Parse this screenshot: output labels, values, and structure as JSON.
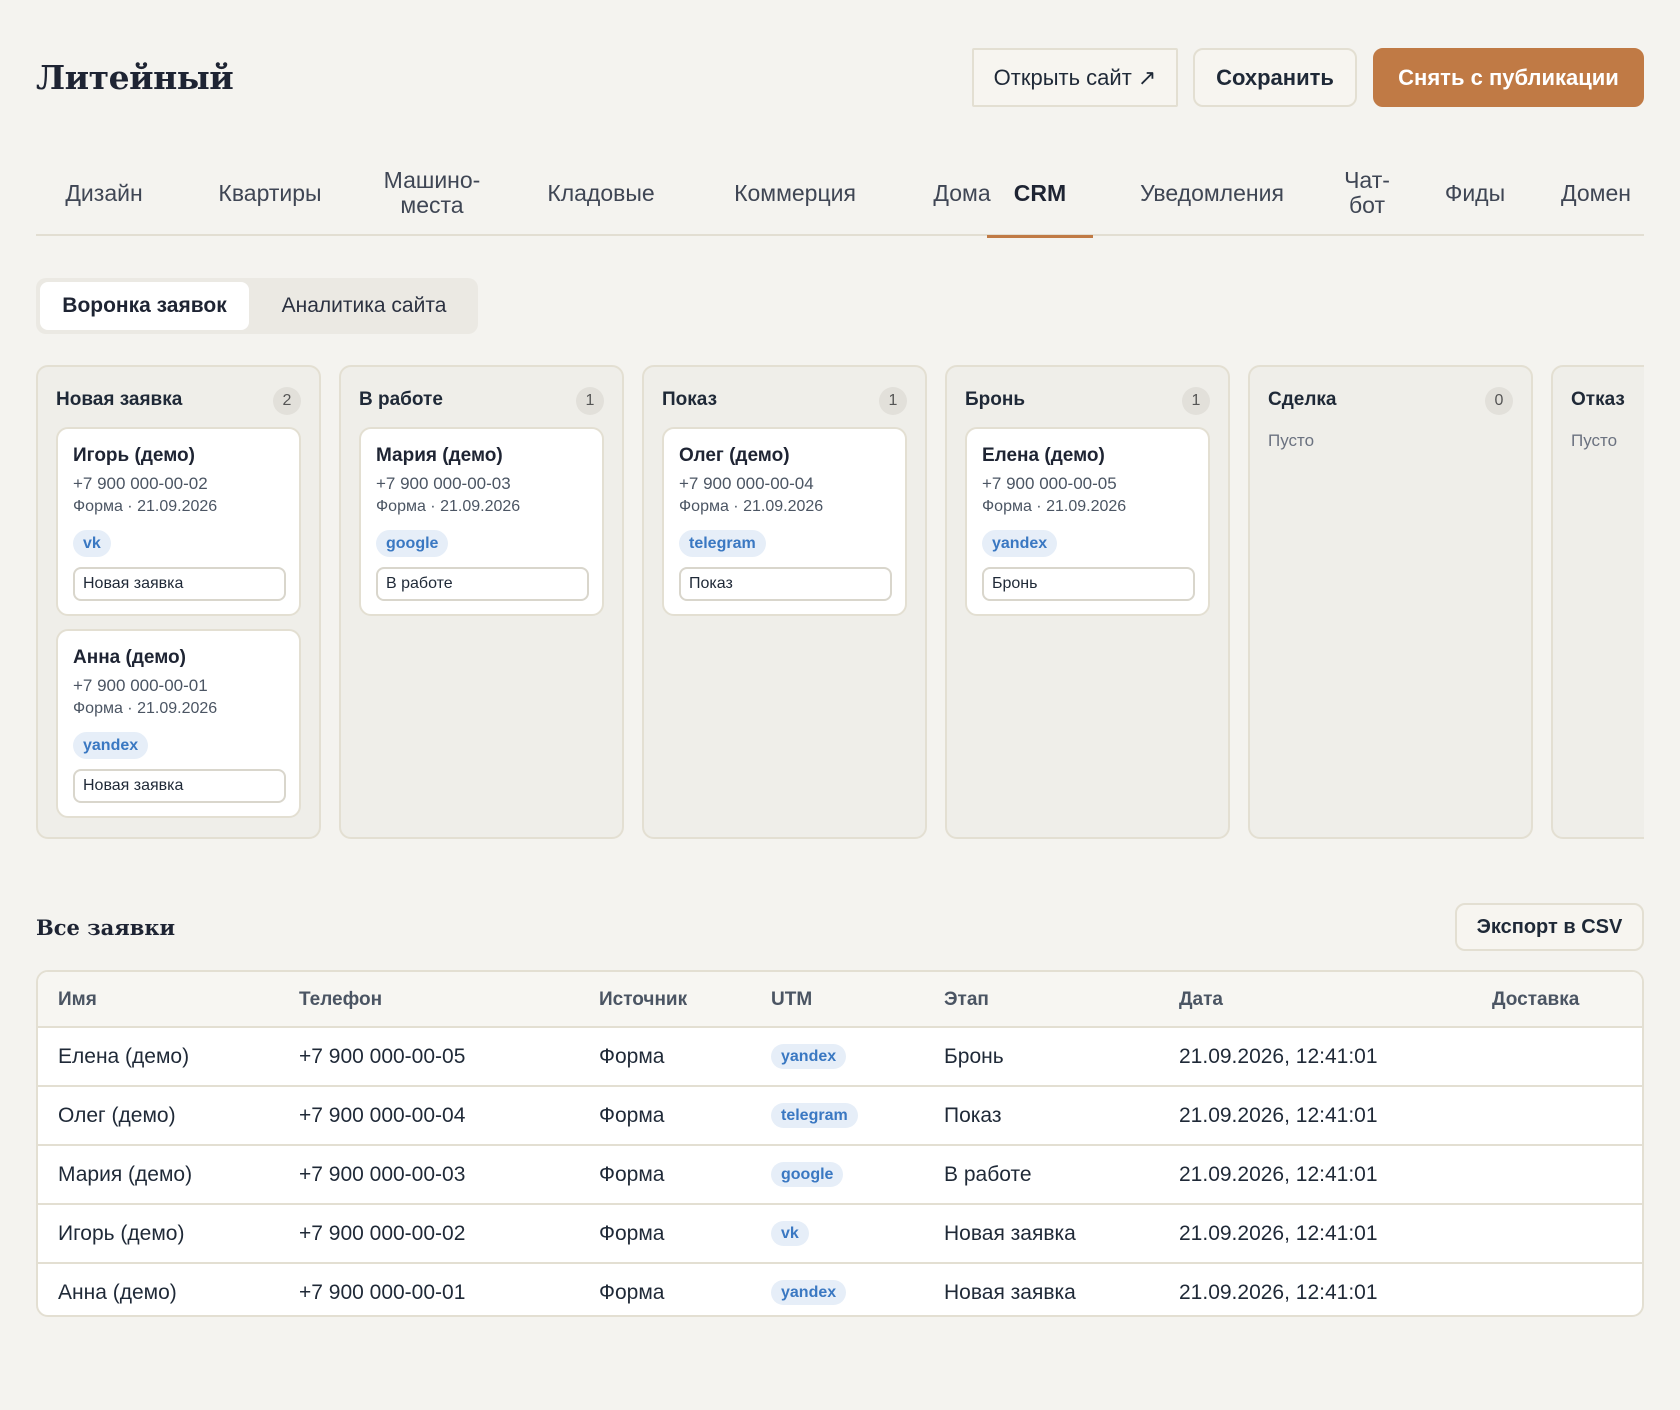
{
  "app": {
    "title": "Литейный"
  },
  "header": {
    "open_site_label": "Открыть сайт ↗",
    "save_label": "Сохранить",
    "unpublish_label": "Снять с публикации"
  },
  "tabs": [
    {
      "label": "Дизайн"
    },
    {
      "label": "Квартиры"
    },
    {
      "label": "Машино-места"
    },
    {
      "label": "Кладовые"
    },
    {
      "label": "Коммерция"
    },
    {
      "label": "Дома"
    },
    {
      "label": "CRM"
    },
    {
      "label": "Уведомления"
    },
    {
      "label": "Чат-бот"
    },
    {
      "label": "Фиды"
    },
    {
      "label": "Домен"
    }
  ],
  "subtabs": {
    "funnel": "Воронка заявок",
    "analytics": "Аналитика сайта"
  },
  "board": {
    "empty_label": "Пусто",
    "columns": [
      {
        "title": "Новая заявка",
        "count": "2"
      },
      {
        "title": "В работе",
        "count": "1"
      },
      {
        "title": "Показ",
        "count": "1"
      },
      {
        "title": "Бронь",
        "count": "1"
      },
      {
        "title": "Сделка",
        "count": "0"
      },
      {
        "title": "Отказ",
        "count": ""
      }
    ],
    "cards": [
      {
        "name": "Игорь (демо)",
        "phone": "+7 900 000-00-02",
        "meta": "Форма · 21.09.2026",
        "tag": "vk",
        "stage": "Новая заявка"
      },
      {
        "name": "Анна (демо)",
        "phone": "+7 900 000-00-01",
        "meta": "Форма · 21.09.2026",
        "tag": "yandex",
        "stage": "Новая заявка"
      },
      {
        "name": "Мария (демо)",
        "phone": "+7 900 000-00-03",
        "meta": "Форма · 21.09.2026",
        "tag": "google",
        "stage": "В работе"
      },
      {
        "name": "Олег (демо)",
        "phone": "+7 900 000-00-04",
        "meta": "Форма · 21.09.2026",
        "tag": "telegram",
        "stage": "Показ"
      },
      {
        "name": "Елена (демо)",
        "phone": "+7 900 000-00-05",
        "meta": "Форма · 21.09.2026",
        "tag": "yandex",
        "stage": "Бронь"
      }
    ]
  },
  "requests": {
    "title": "Все заявки",
    "export_label": "Экспорт в CSV",
    "columns": [
      "Имя",
      "Телефон",
      "Источник",
      "UTM",
      "Этап",
      "Дата",
      "Доставка"
    ],
    "rows": [
      {
        "name": "Елена (демо)",
        "phone": "+7 900 000-00-05",
        "source": "Форма",
        "utm": "yandex",
        "stage": "Бронь",
        "date": "21.09.2026, 12:41:01",
        "delivery": ""
      },
      {
        "name": "Олег (демо)",
        "phone": "+7 900 000-00-04",
        "source": "Форма",
        "utm": "telegram",
        "stage": "Показ",
        "date": "21.09.2026, 12:41:01",
        "delivery": ""
      },
      {
        "name": "Мария (демо)",
        "phone": "+7 900 000-00-03",
        "source": "Форма",
        "utm": "google",
        "stage": "В работе",
        "date": "21.09.2026, 12:41:01",
        "delivery": ""
      },
      {
        "name": "Игорь (демо)",
        "phone": "+7 900 000-00-02",
        "source": "Форма",
        "utm": "vk",
        "stage": "Новая заявка",
        "date": "21.09.2026, 12:41:01",
        "delivery": ""
      },
      {
        "name": "Анна (демо)",
        "phone": "+7 900 000-00-01",
        "source": "Форма",
        "utm": "yandex",
        "stage": "Новая заявка",
        "date": "21.09.2026, 12:41:01",
        "delivery": ""
      }
    ]
  },
  "colors": {
    "accent": "#c07a45",
    "background": "#f4f3ef",
    "tag_text": "#3a78c2",
    "tag_bg": "#e6eef8"
  }
}
